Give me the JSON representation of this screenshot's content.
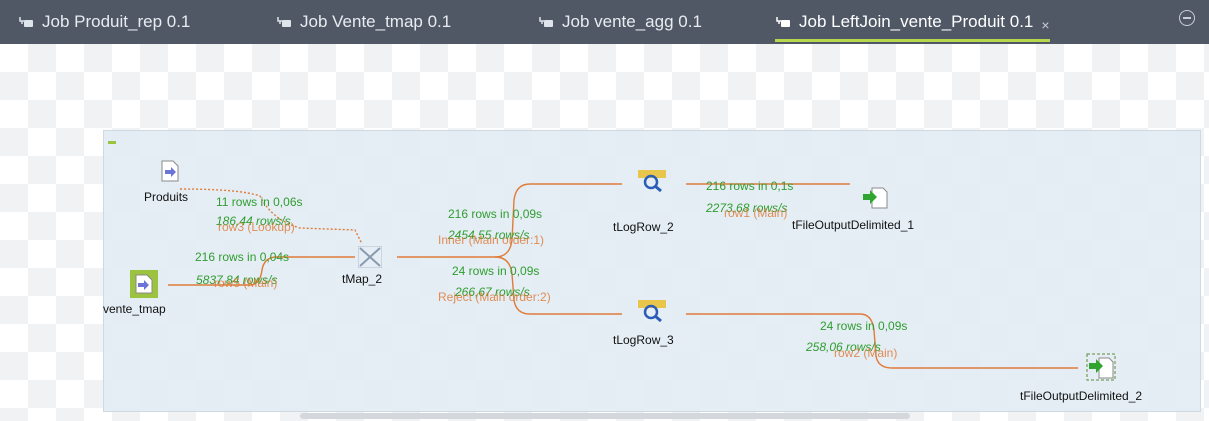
{
  "tabs": [
    {
      "label": "Job Produit_rep 0.1"
    },
    {
      "label": "Job Vente_tmap 0.1"
    },
    {
      "label": "Job vente_agg 0.1"
    },
    {
      "label": "Job LeftJoin_vente_Produit 0.1",
      "active": true,
      "close": "×"
    }
  ],
  "components": {
    "produits": "Produits",
    "vente_tmap": "vente_tmap",
    "tmap": "tMap_2",
    "tlogrow2": "tLogRow_2",
    "tlogrow3": "tLogRow_3",
    "out1": "tFileOutputDelimited_1",
    "out2": "tFileOutputDelimited_2"
  },
  "connections": {
    "row3": "row3 (Lookup)",
    "row5": "row5 (Main)",
    "inner": "Inner (Main order:1)",
    "reject": "Reject (Main order:2)",
    "row1": "row1 (Main)",
    "row2": "row2 (Main)"
  },
  "stats": {
    "lookup_rows": "11 rows in 0,06s",
    "lookup_rate": "186,44 rows/s",
    "main_rows": "216 rows in 0,04s",
    "main_rate": "5837,84 rows/s",
    "inner_rows": "216 rows in 0,09s",
    "inner_rate": "2454,55 rows/s",
    "reject_rows": "24 rows in 0,09s",
    "reject_rate": "266,67 rows/s",
    "row1_rows": "216 rows in 0,1s",
    "row1_rate": "2273,68 rows/s",
    "row2_rows": "24 rows in 0,09s",
    "row2_rate": "258,06 rows/s"
  },
  "colors": {
    "accent": "#b6d74c",
    "link": "#e07b39",
    "stats": "#2f9d2f"
  }
}
